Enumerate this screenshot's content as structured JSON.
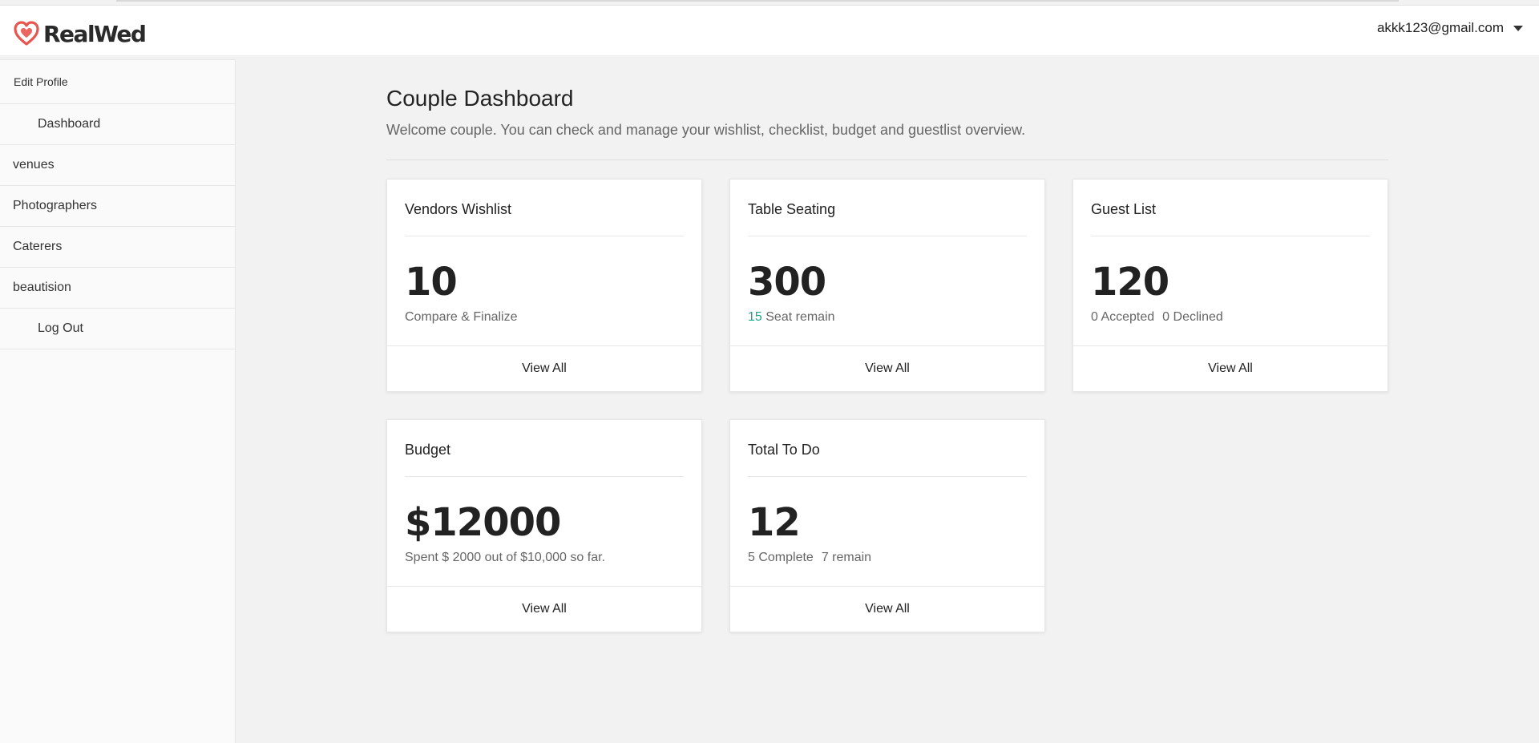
{
  "app": {
    "brand": "RealWed",
    "brand_color": "#e8554e"
  },
  "header": {
    "user_email": "akkk123@gmail.com"
  },
  "sidebar": {
    "items": [
      {
        "label": "Edit Profile"
      },
      {
        "label": "Dashboard"
      },
      {
        "label": "venues"
      },
      {
        "label": "Photographers"
      },
      {
        "label": "Caterers"
      },
      {
        "label": "beautision"
      },
      {
        "label": "Log Out"
      }
    ]
  },
  "main": {
    "title": "Couple Dashboard",
    "subtitle": "Welcome couple. You can check and manage your wishlist, checklist, budget and guestlist overview.",
    "cards": [
      {
        "title": "Vendors Wishlist",
        "value": "10",
        "note": "Compare & Finalize",
        "action": "View All"
      },
      {
        "title": "Table Seating",
        "value": "300",
        "note_accent": "15",
        "note": "Seat remain",
        "action": "View All"
      },
      {
        "title": "Guest List",
        "value": "120",
        "note": "0 Accepted",
        "note2": "0 Declined",
        "action": "View All"
      },
      {
        "title": "Budget",
        "value": "$12000",
        "note": "Spent $ 2000 out of $10,000 so far.",
        "action": "View All"
      },
      {
        "title": "Total To Do",
        "value": "12",
        "note": "5 Complete",
        "note2": "7 remain",
        "action": "View All"
      }
    ]
  },
  "colors": {
    "accent": "#17a589",
    "background": "#f2f2f2"
  }
}
